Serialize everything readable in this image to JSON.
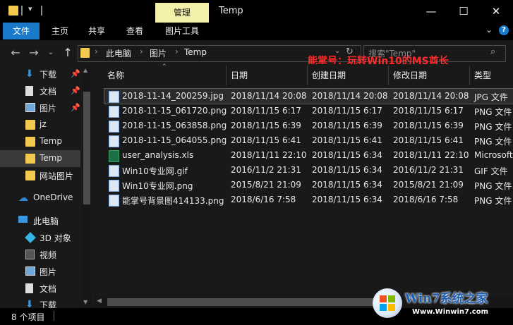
{
  "window": {
    "title": "Temp",
    "context_tab": "管理",
    "controls": [
      "minimize-icon",
      "maximize-icon",
      "close-icon"
    ]
  },
  "ribbon": {
    "tabs": [
      {
        "label": "文件"
      },
      {
        "label": "主页"
      },
      {
        "label": "共享"
      },
      {
        "label": "查看"
      },
      {
        "label": "图片工具"
      }
    ]
  },
  "address": {
    "crumbs": [
      "此电脑",
      "图片",
      "Temp"
    ],
    "search_placeholder": "搜索\"Temp\""
  },
  "overlay_text": "能掌号：玩转Win10的MS酋长",
  "nav": {
    "items": [
      {
        "label": "下载",
        "icon": "download-icon",
        "pinned": true
      },
      {
        "label": "文档",
        "icon": "document-icon",
        "pinned": true
      },
      {
        "label": "图片",
        "icon": "pictures-icon",
        "pinned": true
      },
      {
        "label": "jz",
        "icon": "folder-icon",
        "pinned": false
      },
      {
        "label": "Temp",
        "icon": "folder-icon",
        "pinned": false
      },
      {
        "label": "Temp",
        "icon": "folder-icon",
        "pinned": false,
        "selected": true
      },
      {
        "label": "网站图片",
        "icon": "folder-icon",
        "pinned": false
      },
      {
        "label": "OneDrive",
        "icon": "cloud-icon",
        "pinned": false
      },
      {
        "label": "此电脑",
        "icon": "pc-icon",
        "pinned": false
      },
      {
        "label": "3D 对象",
        "icon": "cube-icon",
        "pinned": false
      },
      {
        "label": "视频",
        "icon": "video-icon",
        "pinned": false
      },
      {
        "label": "图片",
        "icon": "pictures-icon",
        "pinned": false
      },
      {
        "label": "文档",
        "icon": "document-icon",
        "pinned": false
      },
      {
        "label": "下载",
        "icon": "download-icon",
        "pinned": false
      }
    ]
  },
  "columns": [
    "名称",
    "日期",
    "创建日期",
    "修改日期",
    "类型"
  ],
  "files": [
    {
      "name": "2018-11-14_200259.jpg",
      "date": "2018/11/14 20:08",
      "created": "2018/11/14 20:08",
      "modified": "2018/11/14 20:08",
      "type": "JPG 文件",
      "icon": "image-file-icon",
      "selected": true
    },
    {
      "name": "2018-11-15_061720.png",
      "date": "2018/11/15 6:17",
      "created": "2018/11/15 6:17",
      "modified": "2018/11/15 6:17",
      "type": "PNG 文件",
      "icon": "image-file-icon"
    },
    {
      "name": "2018-11-15_063858.png",
      "date": "2018/11/15 6:39",
      "created": "2018/11/15 6:39",
      "modified": "2018/11/15 6:39",
      "type": "PNG 文件",
      "icon": "image-file-icon"
    },
    {
      "name": "2018-11-15_064055.png",
      "date": "2018/11/15 6:41",
      "created": "2018/11/15 6:41",
      "modified": "2018/11/15 6:41",
      "type": "PNG 文件",
      "icon": "image-file-icon"
    },
    {
      "name": "user_analysis.xls",
      "date": "2018/11/11 22:10",
      "created": "2018/11/15 6:34",
      "modified": "2018/11/11 22:10",
      "type": "Microsoft",
      "icon": "excel-file-icon"
    },
    {
      "name": "Win10专业网.gif",
      "date": "2016/11/2 21:31",
      "created": "2018/11/15 6:34",
      "modified": "2016/11/2 21:31",
      "type": "GIF 文件",
      "icon": "image-file-icon"
    },
    {
      "name": "Win10专业网.png",
      "date": "2015/8/21 21:09",
      "created": "2018/11/15 6:34",
      "modified": "2015/8/21 21:09",
      "type": "PNG 文件",
      "icon": "image-file-icon"
    },
    {
      "name": "能掌号背景图414133.png",
      "date": "2018/6/16 7:58",
      "created": "2018/11/15 6:34",
      "modified": "2018/6/16 7:58",
      "type": "PNG 文件",
      "icon": "image-file-icon"
    }
  ],
  "status": {
    "count": "8 个项目"
  },
  "logo": {
    "brand": "Win7系统之家",
    "url": "Www.Winwin7.com"
  },
  "colors": {
    "accent": "#1979ca",
    "context_tab": "#f4f1a8",
    "folder": "#f3c94e",
    "watermark": "#ff2a2a"
  }
}
